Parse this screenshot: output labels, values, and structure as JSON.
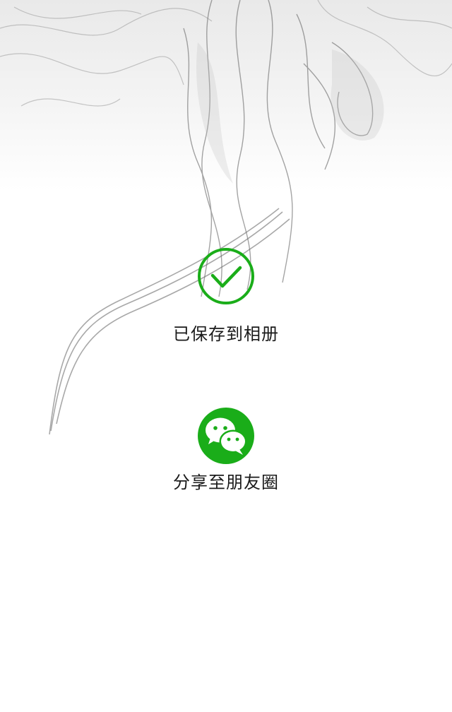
{
  "save_result": {
    "icon": "checkmark-circle-icon",
    "label": "已保存到相册"
  },
  "share": {
    "icon": "wechat-icon",
    "label": "分享至朋友圈"
  },
  "colors": {
    "accent_green": "#1aad19",
    "text": "#1a1a1a",
    "background": "#ffffff",
    "smoke": "#8c8c8c"
  }
}
